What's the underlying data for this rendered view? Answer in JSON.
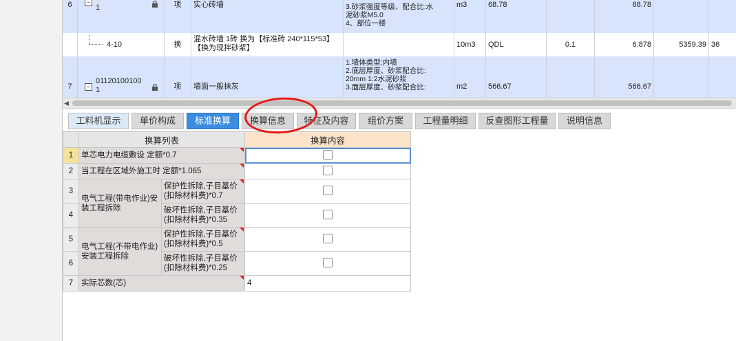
{
  "top_rows": [
    {
      "no": "6",
      "code": "1",
      "type": "项",
      "name": "实心砖墙",
      "desc": [
        "3.砂浆强度等级、配合比:水",
        "泥砂浆M5.0",
        "4、部位一楼"
      ],
      "unit": "m3",
      "qty": "68.78",
      "q3": "68.78"
    },
    {
      "no": "",
      "code": "4-10",
      "type": "换",
      "name": "混水砖墙 1砖   换为【标准砖 240*115*53】  【换为现拌砂浆】",
      "desc": [],
      "unit": "10m3",
      "qty": "QDL",
      "q2": "0.1",
      "q3": "6.878",
      "q4": "5359.39",
      "q5": "36"
    },
    {
      "no": "7",
      "code": "01120100100 1",
      "type": "项",
      "name": "墙面一般抹灰",
      "desc": [
        "1.墙体类型:内墙",
        "2.底层厚度、砂浆配合比:",
        "20mm 1:2水泥砂浆",
        "3.面层厚度、砂浆配合比:"
      ],
      "unit": "m2",
      "qty": "566.67",
      "q3": "566.67"
    }
  ],
  "tabs": [
    "工料机显示",
    "单价构成",
    "标准换算",
    "换算信息",
    "特征及内容",
    "组价方案",
    "工程量明细",
    "反查图形工程量",
    "说明信息"
  ],
  "active_tab": "标准换算",
  "lower_grid": {
    "headers": {
      "list": "换算列表",
      "content": "换算内容"
    },
    "rows": [
      {
        "no": "1",
        "label": "单芯电力电缆敷设 定额*0.7",
        "value": "",
        "checkbox": true
      },
      {
        "no": "2",
        "label": "当工程在区域外施工时 定额*1.065",
        "value": "",
        "checkbox": true
      },
      {
        "no": "3",
        "group": "电气工程(带电作业)安装工程拆除",
        "label": "保护性拆除,子目基价(扣除材料费)*0.7",
        "value": "",
        "checkbox": true
      },
      {
        "no": "4",
        "label": "破坏性拆除,子目基价(扣除材料费)*0.35",
        "value": "",
        "checkbox": true
      },
      {
        "no": "5",
        "group": "电气工程(不带电作业)安装工程拆除",
        "label": "保护性拆除,子目基价(扣除材料费)*0.5",
        "value": "",
        "checkbox": true
      },
      {
        "no": "6",
        "label": "破坏性拆除,子目基价(扣除材料费)*0.25",
        "value": "",
        "checkbox": true
      },
      {
        "no": "7",
        "label": "实际芯数(芯)",
        "value": "4",
        "checkbox": false
      }
    ]
  },
  "colors": {
    "accent": "#3b8de0",
    "annotation": "#e51a1a",
    "row_highlight": "#d7e4fb"
  }
}
